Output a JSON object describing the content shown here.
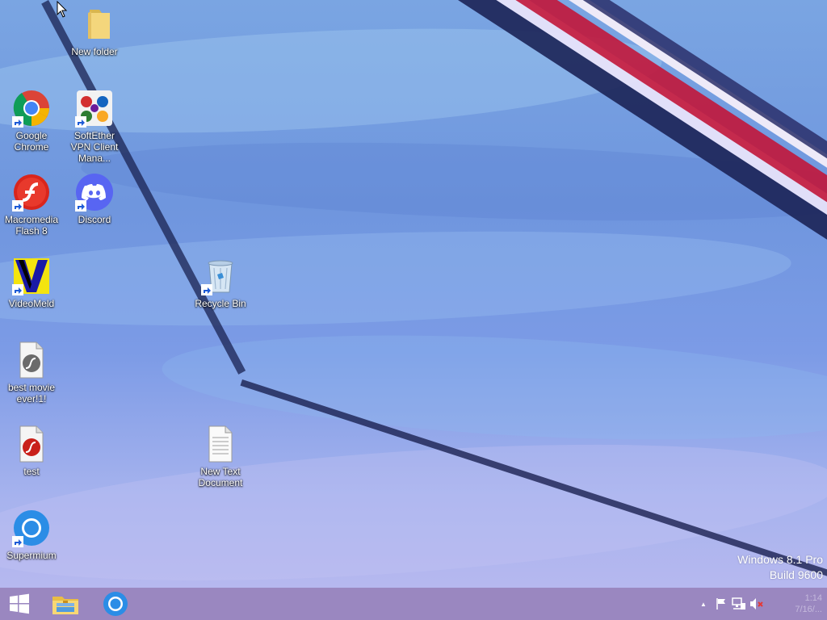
{
  "desktop": {
    "icons": [
      {
        "name": "new-folder",
        "label": "New folder",
        "icon": "folder-icon"
      },
      {
        "name": "google-chrome",
        "label": "Google Chrome",
        "icon": "chrome-icon"
      },
      {
        "name": "softether-vpn",
        "label": "SoftEther VPN Client Mana...",
        "icon": "softether-icon"
      },
      {
        "name": "macromedia-flash",
        "label": "Macromedia Flash 8",
        "icon": "flash-icon"
      },
      {
        "name": "discord",
        "label": "Discord",
        "icon": "discord-icon"
      },
      {
        "name": "videomeld",
        "label": "VideoMeld",
        "icon": "videomeld-icon"
      },
      {
        "name": "recycle-bin",
        "label": "Recycle Bin",
        "icon": "recycle-bin-icon"
      },
      {
        "name": "best-movie",
        "label": "best movie ever!1!",
        "icon": "flash-file-icon"
      },
      {
        "name": "test",
        "label": "test",
        "icon": "flash-doc-icon"
      },
      {
        "name": "new-text-document",
        "label": "New Text Document",
        "icon": "text-file-icon"
      },
      {
        "name": "supermium",
        "label": "Supermium",
        "icon": "supermium-icon"
      }
    ],
    "watermark": {
      "line1": "Windows 8.1 Pro",
      "line2": "Build 9600"
    }
  },
  "taskbar": {
    "start_icon": "windows-start-icon",
    "pinned": [
      {
        "name": "file-explorer",
        "icon": "file-explorer-icon"
      },
      {
        "name": "supermium",
        "icon": "supermium-icon"
      }
    ],
    "tray": {
      "chevron": "▲",
      "clock_time": "1:14",
      "clock_date": "7/16/..."
    }
  }
}
